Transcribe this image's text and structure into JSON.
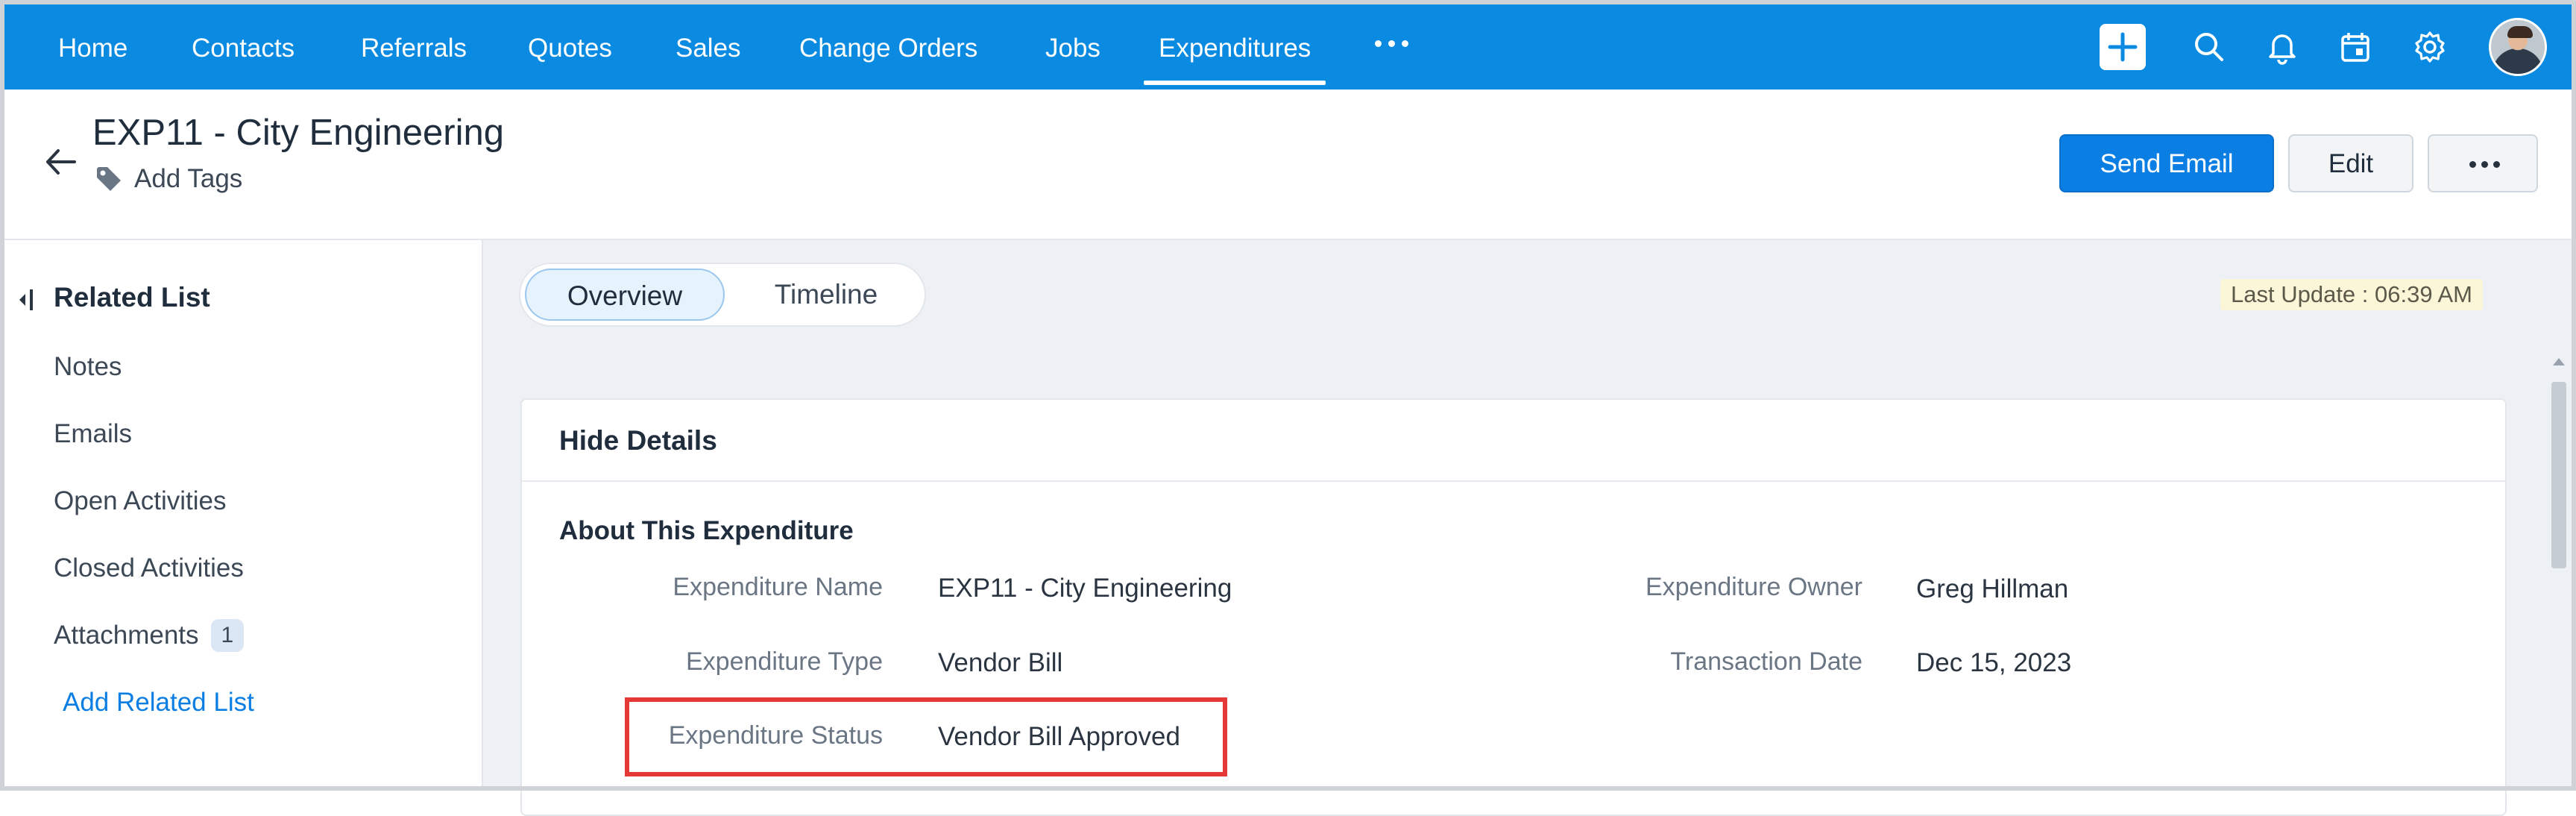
{
  "nav": {
    "items": [
      "Home",
      "Contacts",
      "Referrals",
      "Quotes",
      "Sales",
      "Change Orders",
      "Jobs",
      "Expenditures"
    ],
    "active": "Expenditures"
  },
  "colors": {
    "nav_bg": "#0a8ae1",
    "primary": "#0b7ee4",
    "highlight": "#e53935"
  },
  "record": {
    "title": "EXP11 - City Engineering",
    "add_tags": "Add Tags",
    "send_email": "Send Email",
    "edit": "Edit"
  },
  "sidebar": {
    "title": "Related List",
    "items": [
      {
        "label": "Notes"
      },
      {
        "label": "Emails"
      },
      {
        "label": "Open Activities"
      },
      {
        "label": "Closed Activities"
      },
      {
        "label": "Attachments",
        "badge": "1"
      }
    ],
    "add_link": "Add Related List"
  },
  "main": {
    "tabs": [
      "Overview",
      "Timeline"
    ],
    "active_tab": "Overview",
    "last_update": "Last Update : 06:39 AM",
    "card_header": "Hide Details",
    "section_title": "About This Expenditure",
    "fields": {
      "expenditure_name": {
        "label": "Expenditure Name",
        "value": "EXP11 - City Engineering"
      },
      "expenditure_owner": {
        "label": "Expenditure Owner",
        "value": "Greg Hillman"
      },
      "expenditure_type": {
        "label": "Expenditure Type",
        "value": "Vendor Bill"
      },
      "transaction_date": {
        "label": "Transaction Date",
        "value": "Dec 15, 2023"
      },
      "expenditure_status": {
        "label": "Expenditure Status",
        "value": "Vendor Bill Approved"
      }
    }
  }
}
